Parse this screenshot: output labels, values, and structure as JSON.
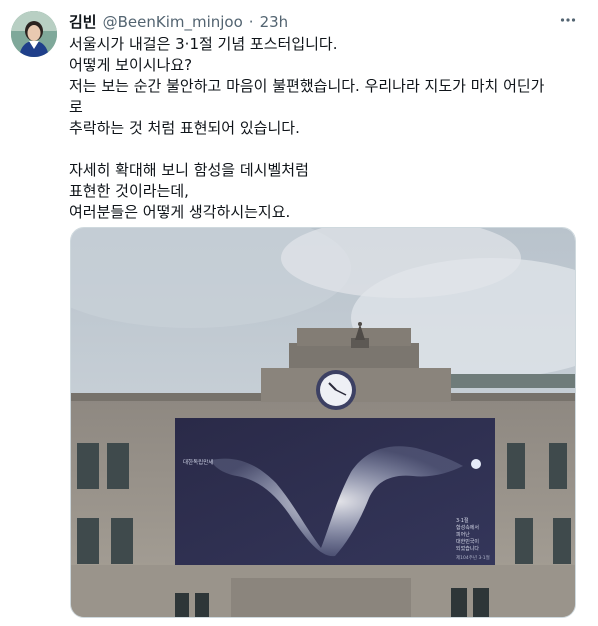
{
  "tweet": {
    "author_name": "김빈",
    "author_handle": "@BeenKim_minjoo",
    "separator": "·",
    "time_ago": "23h",
    "more_icon": "more-horizontal-icon",
    "lines": [
      "서울시가 내걸은 3·1절 기념 포스터입니다.",
      "어떻게 보이시나요?",
      "저는 보는 순간 불안하고 마음이 불편했습니다. 우리나라 지도가 마치 어딘가",
      "로",
      "추락하는 것 처럼 표현되어 있습니다.",
      "",
      "자세히 확대해 보니 함성을 데시벨처럼",
      "표현한 것이라는데,",
      "여러분들은 어떻게 생각하시는지요."
    ]
  },
  "poster": {
    "left_text": "대한독립만세",
    "right_text": [
      "3·1절",
      "함성속에서",
      "피어난",
      "대한민국이",
      "되었습니다"
    ],
    "footer": "제104주년 3·1절"
  }
}
